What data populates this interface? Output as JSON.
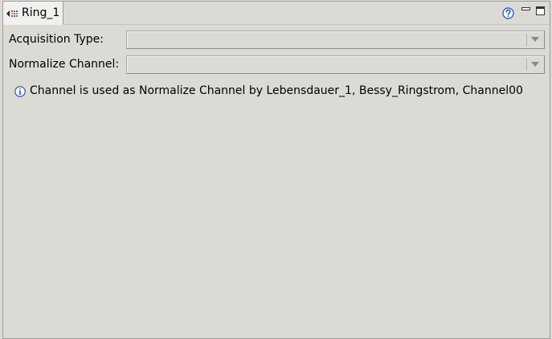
{
  "tab": {
    "label": "Ring_1",
    "icon": "channel-view-icon"
  },
  "toolbar": {
    "help_icon": "help-icon",
    "minimize_icon": "minimize-icon",
    "maximize_icon": "maximize-icon"
  },
  "form": {
    "acquisition_type": {
      "label": "Acquisition Type:",
      "value": ""
    },
    "normalize_channel": {
      "label": "Normalize Channel:",
      "value": ""
    }
  },
  "info": {
    "icon": "info-icon",
    "message": "Channel is used as Normalize Channel by Lebensdauer_1, Bessy_Ringstrom, Channel00"
  },
  "colors": {
    "background": "#dcdad5",
    "active_tab": "#f1f0ee",
    "info_icon": "#3a63a8",
    "help_icon": "#2f62b8"
  }
}
